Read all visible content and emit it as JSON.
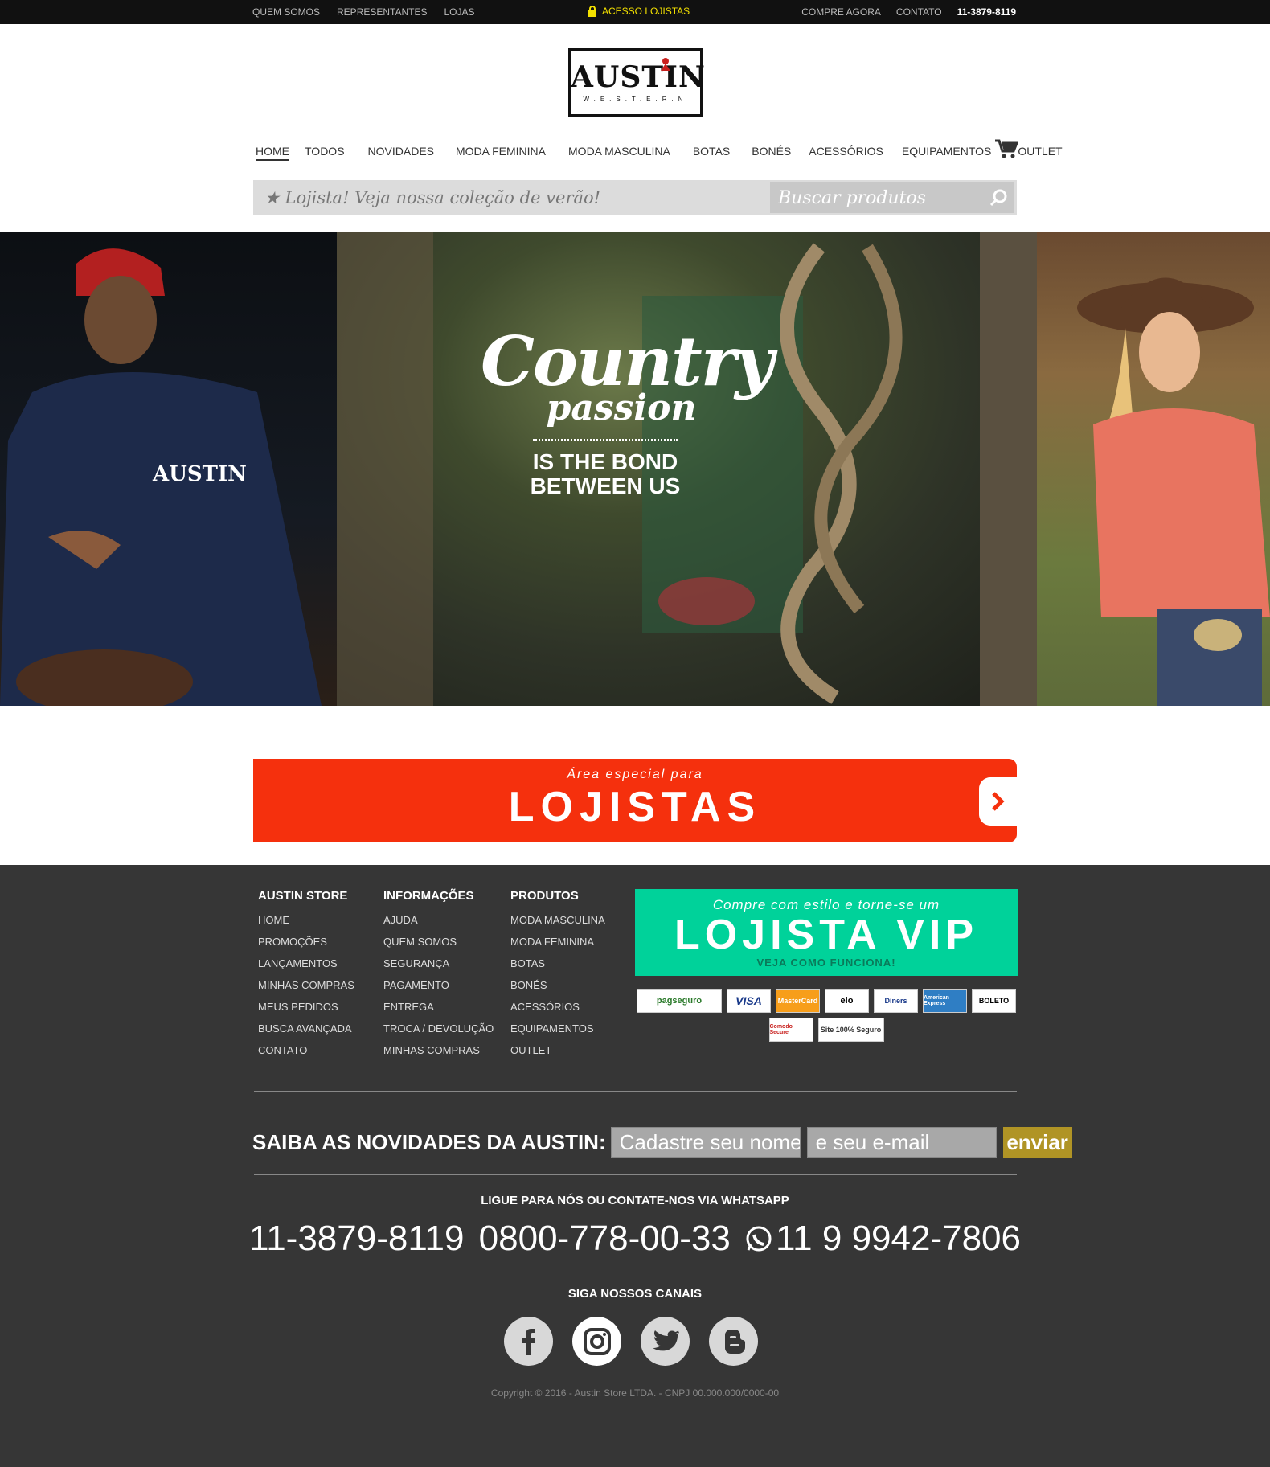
{
  "topbar": {
    "links_left": [
      "QUEM SOMOS",
      "REPRESENTANTES",
      "LOJAS"
    ],
    "center": "ACESSO LOJISTAS",
    "links_right": [
      "COMPRE AGORA",
      "CONTATO"
    ],
    "phone": "11-3879-8119"
  },
  "logo": {
    "word": "AUSTIN",
    "sub": "W.E.S.T.E.R.N"
  },
  "nav": [
    "HOME",
    "TODOS",
    "NOVIDADES",
    "MODA FEMININA",
    "MODA MASCULINA",
    "BOTAS",
    "BONÉS",
    "ACESSÓRIOS",
    "EQUIPAMENTOS",
    "OUTLET"
  ],
  "search": {
    "promo": "Lojista! Veja nossa coleção de verão!",
    "placeholder": "Buscar produtos"
  },
  "hero": {
    "script1": "Country",
    "script2": "passion",
    "line1": "IS THE BOND",
    "line2": "BETWEEN US"
  },
  "lojistas_banner": {
    "small": "Área especial para",
    "big": "LOJISTAS"
  },
  "footer": {
    "columns": [
      {
        "title": "AUSTIN STORE",
        "items": [
          "HOME",
          "PROMOÇÕES",
          "LANÇAMENTOS",
          "MINHAS COMPRAS",
          "MEUS PEDIDOS",
          "BUSCA AVANÇADA",
          "CONTATO"
        ]
      },
      {
        "title": "INFORMAÇÕES",
        "items": [
          "AJUDA",
          "QUEM SOMOS",
          "SEGURANÇA",
          "PAGAMENTO",
          "ENTREGA",
          "TROCA / DEVOLUÇÃO",
          "MINHAS COMPRAS"
        ]
      },
      {
        "title": "PRODUTOS",
        "items": [
          "MODA MASCULINA",
          "MODA FEMININA",
          "BOTAS",
          "BONÉS",
          "ACESSÓRIOS",
          "EQUIPAMENTOS",
          "OUTLET"
        ]
      }
    ],
    "vip": {
      "line1": "Compre com estilo e torne-se um",
      "line2": "LOJISTA VIP",
      "line3": "VEJA COMO FUNCIONA!"
    },
    "payments": [
      "pagseguro",
      "VISA",
      "MasterCard",
      "elo",
      "Diners",
      "American Express",
      "BOLETO",
      "Comodo Secure",
      "Site 100% Seguro"
    ],
    "newsletter": {
      "label": "SAIBA AS NOVIDADES DA AUSTIN:",
      "name_placeholder": "Cadastre seu nome",
      "email_placeholder": "e seu e-mail",
      "button": "enviar"
    },
    "contact_title": "LIGUE PARA NÓS OU CONTATE-NOS VIA WHATSAPP",
    "phones": [
      "11-3879-8119",
      "0800-778-00-33",
      "11 9 9942-7806"
    ],
    "social_title": "SIGA NOSSOS CANAIS",
    "social": [
      "facebook-icon",
      "instagram-icon",
      "twitter-icon",
      "blogger-icon"
    ],
    "copyright": "Copyright © 2016 - Austin Store LTDA. - CNPJ 00.000.000/0000-00"
  },
  "colors": {
    "accent_red": "#f5300d",
    "vip_green": "#00d29a",
    "footer_bg": "#363636",
    "gold": "#b09425",
    "yellow": "#f4e100"
  }
}
